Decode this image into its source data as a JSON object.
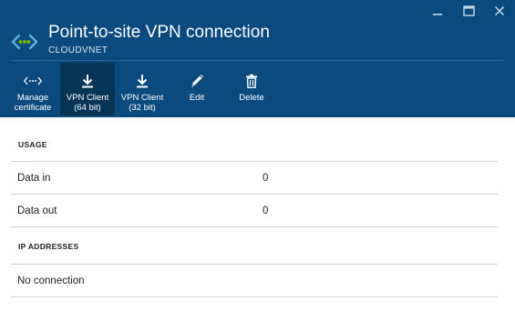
{
  "header": {
    "title": "Point-to-site VPN connection",
    "subtitle": "CLOUDVNET",
    "icon": "vpn-gateway-icon",
    "background": "#0a4a7f"
  },
  "window_controls": {
    "minimize_icon": "minimize-icon",
    "maximize_icon": "maximize-icon",
    "close_icon": "close-icon"
  },
  "toolbar": {
    "manage_certificate": {
      "line1": "Manage",
      "line2": "certificate",
      "icon": "manage-certificate-icon"
    },
    "vpn_client_64": {
      "line1": "VPN Client",
      "line2": "(64 bit)",
      "icon": "download-icon",
      "active": true
    },
    "vpn_client_32": {
      "line1": "VPN Client",
      "line2": "(32 bit)",
      "icon": "download-icon"
    },
    "edit": {
      "label": "Edit",
      "icon": "edit-icon"
    },
    "delete": {
      "label": "Delete",
      "icon": "delete-icon"
    }
  },
  "usage": {
    "heading": "USAGE",
    "rows": [
      {
        "label": "Data in",
        "value": "0"
      },
      {
        "label": "Data out",
        "value": "0"
      }
    ]
  },
  "ip_addresses": {
    "heading": "IP ADDRESSES",
    "value": "No connection"
  }
}
